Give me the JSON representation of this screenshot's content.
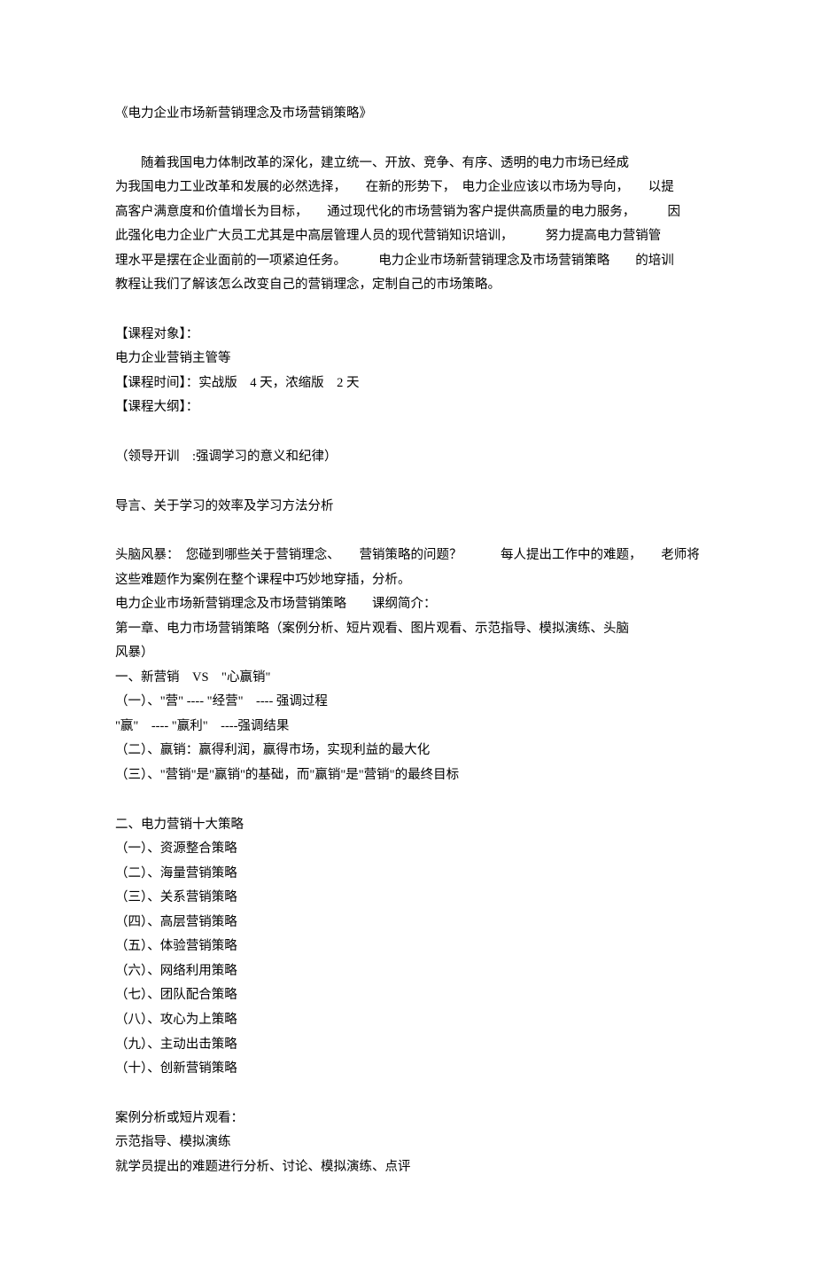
{
  "title": "《电力企业市场新营销理念及市场营销策略》",
  "intro": {
    "l1": "随着我国电力体制改革的深化，建立统一、开放、竞争、有序、透明的电力市场已经成",
    "l2": "为我国电力工业改革和发展的必然选择，　　在新的形势下，　电力企业应该以市场为导向，　　以提",
    "l3": "高客户满意度和价值增长为目标，　　通过现代化的市场营销为客户提供高质量的电力服务，　　　因",
    "l4": "此强化电力企业广大员工尤其是中高层管理人员的现代营销知识培训，　　　努力提高电力营销管",
    "l5": "理水平是摆在企业面前的一项紧迫任务。　　　电力企业市场新营销理念及市场营销策略　　的培训",
    "l6": "教程让我们了解该怎么改变自己的营销理念，定制自己的市场策略。"
  },
  "courseTarget": {
    "label": "【课程对象】：",
    "value": "电力企业营销主管等"
  },
  "courseTime": {
    "label": "【课程时间】",
    "value": "：实战版　4 天，浓缩版　2 天"
  },
  "courseOutline": {
    "label": "【课程大纲】："
  },
  "leaderNote": "（领导开训　:强调学习的意义和纪律）",
  "preface": "导言、关于学习的效率及学习方法分析",
  "brainstorm": {
    "l1": "头脑风暴：　您碰到哪些关于营销理念、　　营销策略的问题？　　　每人提出工作中的难题，　　老师将",
    "l2": "这些难题作为案例在整个课程中巧妙地穿插，分析。"
  },
  "outlineIntro": "电力企业市场新营销理念及市场营销策略　　课纲简介：",
  "chapter1": {
    "title": "第一章、电力市场营销策略（案例分析、短片观看、图片观看、示范指导、模拟演练、头脑",
    "title2": "风暴）"
  },
  "section1": {
    "heading": "一、新营销　VS　\"心赢销\"",
    "item1": "（一）、\"营\" ---- \"经营\"　---- 强调过程",
    "item1b": "\"赢\"　---- \"赢利\"　----强调结果",
    "item2": "（二）、赢销：赢得利润，赢得市场，实现利益的最大化",
    "item3": "（三）、\"营销\"是\"赢销\"的基础，而\"赢销\"是\"营销\"的最终目标"
  },
  "section2": {
    "heading": "二、电力营销十大策略",
    "items": [
      "（一）、资源整合策略",
      "（二）、海量营销策略",
      "（三）、关系营销策略",
      "（四）、高层营销策略",
      "（五）、体验营销策略",
      "（六）、网络利用策略",
      "（七）、团队配合策略",
      "（八）、攻心为上策略",
      "（九）、主动出击策略",
      "（十）、创新营销策略"
    ]
  },
  "footer": {
    "l1": "案例分析或短片观看：",
    "l2": "示范指导、模拟演练",
    "l3": "就学员提出的难题进行分析、讨论、模拟演练、点评"
  }
}
